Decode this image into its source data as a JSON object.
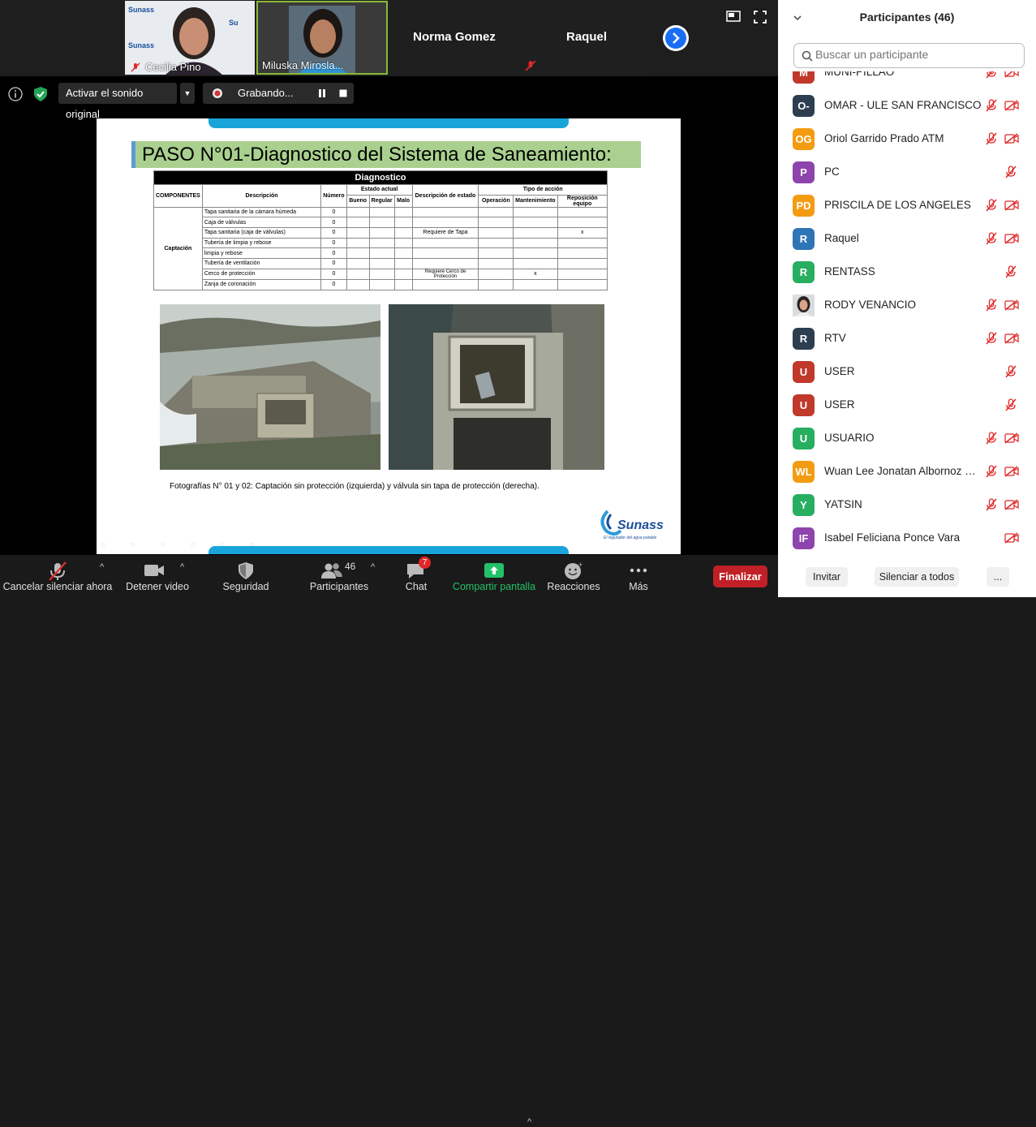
{
  "tiles": [
    {
      "name": "Cecilia Pino"
    },
    {
      "name": "Miluska Mirosla..."
    },
    {
      "name": "Norma Gomez"
    },
    {
      "name": "Raquel"
    }
  ],
  "infobar": {
    "original_audio": "Activar el sonido original",
    "recording": "Grabando..."
  },
  "slide": {
    "title": "PASO N°01-Diagnostico del Sistema de Saneamiento:",
    "table": {
      "heading": "Diagnostico",
      "col_componentes": "COMPONENTES",
      "col_descripcion": "Descripción",
      "col_numero": "Número",
      "col_estado": "Estado actual",
      "col_bueno": "Bueno",
      "col_regular": "Regular",
      "col_malo": "Malo",
      "col_desc_estado": "Descripción de estado",
      "col_tipo": "Tipo de acción",
      "col_operacion": "Operación",
      "col_mantenimiento": "Mantenimiento",
      "col_reposicion": "Reposición equipo",
      "component": "Captación",
      "rows": [
        {
          "desc": "Tapa sanitaria de la cámara húmeda",
          "num": "0",
          "estado": "",
          "mant": "",
          "repo": ""
        },
        {
          "desc": "Caja de válvulas",
          "num": "0",
          "estado": "",
          "mant": "",
          "repo": ""
        },
        {
          "desc": "Tapa sanitaria (caja de válvulas)",
          "num": "0",
          "estado": "Requiere de Tapa",
          "mant": "",
          "repo": "x"
        },
        {
          "desc": "Tubería de limpia y rebose",
          "num": "0",
          "estado": "",
          "mant": "",
          "repo": ""
        },
        {
          "desc": "limpia y rebose",
          "num": "0",
          "estado": "",
          "mant": "",
          "repo": ""
        },
        {
          "desc": "Tubería de ventilación",
          "num": "0",
          "estado": "",
          "mant": "",
          "repo": ""
        },
        {
          "desc": "Cerco de protección",
          "num": "0",
          "estado": "Requiere Cerco de Protección",
          "mant": "x",
          "repo": ""
        },
        {
          "desc": "Zanja de coronación",
          "num": "0",
          "estado": "",
          "mant": "",
          "repo": ""
        }
      ]
    },
    "caption": "Fotografías N° 01 y 02: Captación sin protección (izquierda) y válvula sin tapa de protección (derecha).",
    "logo": {
      "text": "Sunass",
      "tagline": "El regulador del agua potable"
    }
  },
  "toolbar": {
    "mute": "Cancelar silenciar ahora",
    "video": "Detener video",
    "security": "Seguridad",
    "participants": "Participantes",
    "participants_count": "46",
    "chat": "Chat",
    "chat_badge": "7",
    "share": "Compartir pantalla",
    "reactions": "Reacciones",
    "more": "Más",
    "end": "Finalizar"
  },
  "panel": {
    "title": "Participantes (46)",
    "search_placeholder": "Buscar un participante",
    "participants": [
      {
        "initials": "M",
        "name": "MUNI-PILLAO",
        "color": "#c0392b",
        "mic_muted": true,
        "cam_off": true
      },
      {
        "initials": "O-",
        "name": "OMAR - ULE SAN FRANCISCO",
        "color": "#2c3e50",
        "mic_muted": true,
        "cam_off": true
      },
      {
        "initials": "OG",
        "name": "Oriol Garrido Prado ATM",
        "color": "#f39c12",
        "mic_muted": true,
        "cam_off": true
      },
      {
        "initials": "P",
        "name": "PC",
        "color": "#8e44ad",
        "mic_muted": true,
        "cam_off": false
      },
      {
        "initials": "PD",
        "name": "PRISCILA DE LOS ANGELES",
        "color": "#f39c12",
        "mic_muted": true,
        "cam_off": true
      },
      {
        "initials": "R",
        "name": "Raquel",
        "color": "#2e75b6",
        "mic_muted": true,
        "cam_off": true
      },
      {
        "initials": "R",
        "name": "RENTASS",
        "color": "#27ae60",
        "mic_muted": true,
        "cam_off": false
      },
      {
        "initials": "",
        "name": "RODY VENANCIO",
        "color": "#7a5a4a",
        "mic_muted": true,
        "cam_off": true
      },
      {
        "initials": "R",
        "name": "RTV",
        "color": "#2c3e50",
        "mic_muted": true,
        "cam_off": true
      },
      {
        "initials": "U",
        "name": "USER",
        "color": "#c0392b",
        "mic_muted": true,
        "cam_off": false
      },
      {
        "initials": "U",
        "name": "USER",
        "color": "#c0392b",
        "mic_muted": true,
        "cam_off": false
      },
      {
        "initials": "U",
        "name": "USUARIO",
        "color": "#27ae60",
        "mic_muted": true,
        "cam_off": true
      },
      {
        "initials": "WL",
        "name": "Wuan Lee Jonatan Albornoz Ra...",
        "color": "#f39c12",
        "mic_muted": true,
        "cam_off": true
      },
      {
        "initials": "Y",
        "name": "YATSIN",
        "color": "#27ae60",
        "mic_muted": true,
        "cam_off": true
      },
      {
        "initials": "IF",
        "name": "Isabel Feliciana Ponce Vara",
        "color": "#8e44ad",
        "mic_muted": false,
        "cam_off": true
      }
    ],
    "invite": "Invitar",
    "mute_all": "Silenciar a todos",
    "more": "..."
  }
}
